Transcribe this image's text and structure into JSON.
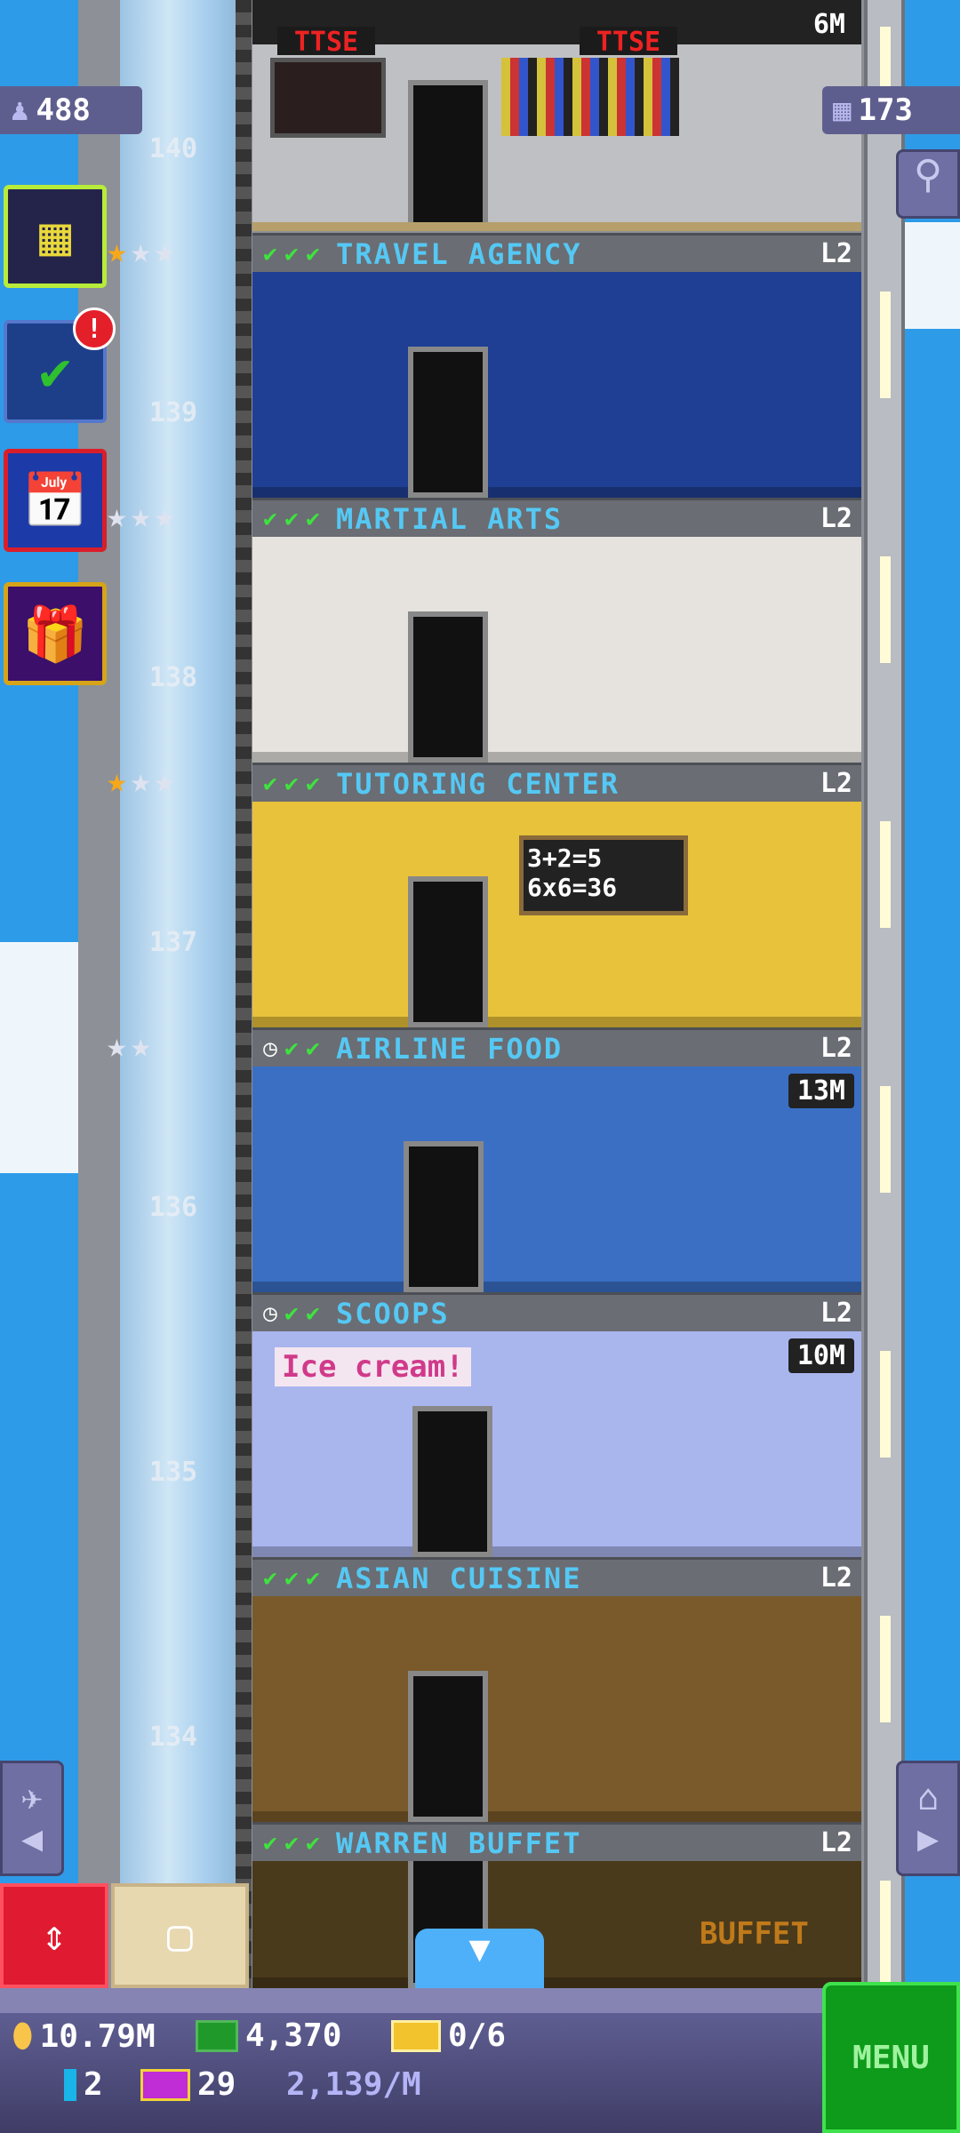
{
  "hud": {
    "population": "488",
    "floors_count": "173"
  },
  "top_floor": {
    "number": "140",
    "signs": [
      "TTSE",
      "TTSE"
    ],
    "badge": "6M"
  },
  "floors": [
    {
      "name": "TRAVEL AGENCY",
      "level": "L2",
      "number": "139",
      "status": [
        "check",
        "check",
        "check"
      ],
      "stars": [
        "gold",
        "silver",
        "silver"
      ],
      "bg": "#1f3f94",
      "badge": ""
    },
    {
      "name": "MARTIAL ARTS",
      "level": "L2",
      "number": "138",
      "status": [
        "check",
        "check",
        "check"
      ],
      "stars": [
        "silver",
        "silver",
        "silver"
      ],
      "bg": "#e6e3df",
      "badge": ""
    },
    {
      "name": "TUTORING CENTER",
      "level": "L2",
      "number": "137",
      "status": [
        "check",
        "check",
        "check"
      ],
      "stars": [
        "gold",
        "silver",
        "silver"
      ],
      "bg": "#e8c23a",
      "badge": "",
      "board": "3+2=5 6x6=36"
    },
    {
      "name": "AIRLINE FOOD",
      "level": "L2",
      "number": "136",
      "status": [
        "clock",
        "check",
        "check"
      ],
      "stars": [
        "silver",
        "silver"
      ],
      "bg": "#3a6fc4",
      "badge": "13M"
    },
    {
      "name": "SCOOPS",
      "level": "L2",
      "number": "135",
      "status": [
        "clock",
        "check",
        "check"
      ],
      "stars": [],
      "bg": "#a9b6ee",
      "badge": "10M",
      "sign": "Ice cream!"
    },
    {
      "name": "ASIAN CUISINE",
      "level": "L2",
      "number": "134",
      "status": [
        "check",
        "check",
        "check"
      ],
      "stars": [],
      "bg": "#7a5a2a",
      "badge": ""
    },
    {
      "name": "WARREN BUFFET",
      "level": "L2",
      "number": "",
      "status": [
        "check",
        "check",
        "check"
      ],
      "stars": [],
      "bg": "#4a3a1c",
      "badge": "",
      "sign": "BUFFET"
    }
  ],
  "stats": {
    "coins": "10.79M",
    "bux": "4,370",
    "golden_tickets": "0/6",
    "bitizen_cards": "2",
    "vip": "29",
    "income": "2,139/M"
  },
  "menu_label": "MENU",
  "alert_badge": "!"
}
